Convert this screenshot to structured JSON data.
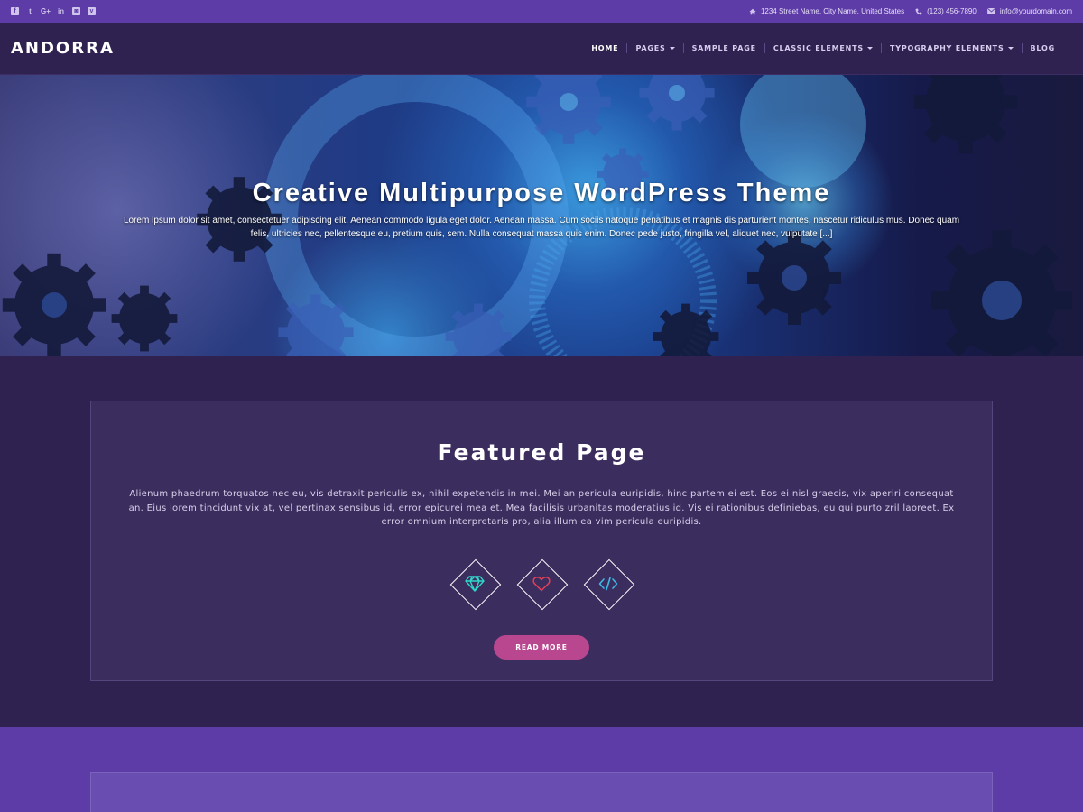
{
  "topbar": {
    "socials": [
      {
        "name": "facebook-icon",
        "glyph": "f"
      },
      {
        "name": "twitter-icon",
        "glyph": "t"
      },
      {
        "name": "google-plus-icon",
        "glyph": "G+"
      },
      {
        "name": "linkedin-icon",
        "glyph": "in"
      },
      {
        "name": "instagram-icon",
        "glyph": "◙"
      },
      {
        "name": "vimeo-icon",
        "glyph": "v"
      }
    ],
    "address": "1234 Street Name, City Name, United States",
    "phone": "(123) 456-7890",
    "email": "info@yourdomain.com"
  },
  "header": {
    "brand": "ANDORRA",
    "nav": [
      {
        "label": "HOME",
        "dropdown": false
      },
      {
        "label": "PAGES",
        "dropdown": true
      },
      {
        "label": "SAMPLE PAGE",
        "dropdown": false
      },
      {
        "label": "CLASSIC ELEMENTS",
        "dropdown": true
      },
      {
        "label": "TYPOGRAPHY ELEMENTS",
        "dropdown": true
      },
      {
        "label": "BLOG",
        "dropdown": false
      }
    ]
  },
  "hero": {
    "title": "Creative Multipurpose WordPress Theme",
    "description": "Lorem ipsum dolor sit amet, consectetuer adipiscing elit. Aenean commodo ligula eget dolor. Aenean massa. Cum sociis natoque penatibus et magnis dis parturient montes, nascetur ridiculus mus. Donec quam felis, ultricies nec, pellentesque eu, pretium quis, sem. Nulla consequat massa quis enim. Donec pede justo, fringilla vel, aliquet nec, vulputate [...]"
  },
  "featured": {
    "title": "Featured Page",
    "text": "Alienum phaedrum torquatos nec eu, vis detraxit periculis ex, nihil expetendis in mei. Mei an pericula euripidis, hinc partem ei est. Eos ei nisl graecis, vix aperiri consequat an. Eius lorem tincidunt vix at, vel pertinax sensibus id, error epicurei mea et. Mea facilisis urbanitas moderatius id. Vis ei rationibus definiebas, eu qui purto zril laoreet. Ex error omnium interpretaris pro, alia illum ea vim pericula euripidis.",
    "icons": [
      {
        "name": "diamond-icon",
        "color": "#2fd6c8"
      },
      {
        "name": "heart-icon",
        "color": "#e2405a"
      },
      {
        "name": "code-icon",
        "color": "#3fb8e6"
      }
    ],
    "button": "READ MORE"
  },
  "colors": {
    "topbar": "#5e3ca8",
    "header": "#2f2150",
    "card": "#3b2d5e",
    "accent_button": "#b8478f"
  }
}
